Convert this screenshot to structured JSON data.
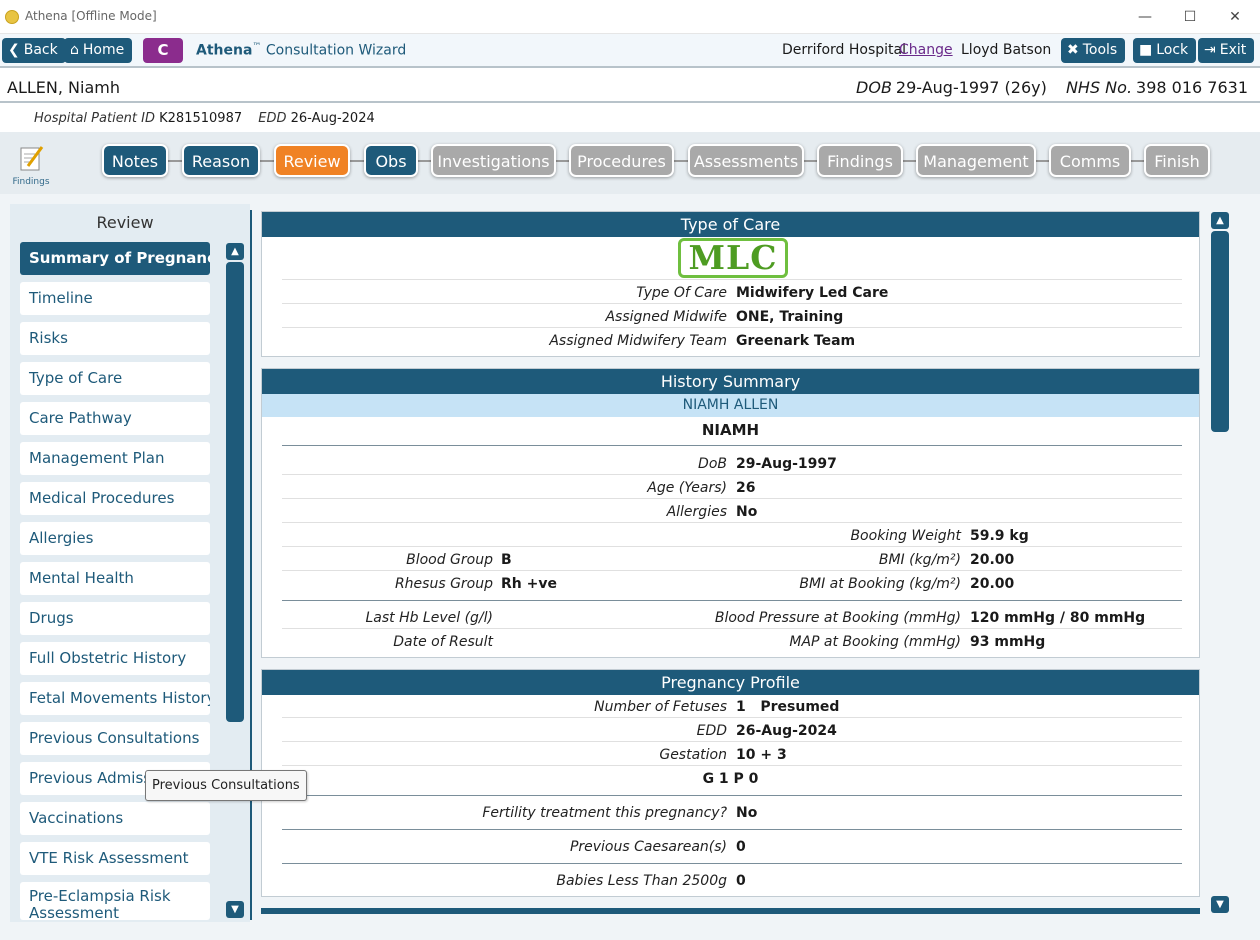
{
  "window": {
    "title": "Athena [Offline Mode]"
  },
  "toolbar": {
    "back_label": "Back",
    "home_label": "Home",
    "c_label": "C",
    "app_name": "Athena",
    "app_tm": "™",
    "app_subtitle": "Consultation Wizard",
    "hospital": "Derriford Hospital",
    "change_link": "Change",
    "user": "Lloyd Batson",
    "tools_label": "Tools",
    "lock_label": "Lock",
    "exit_label": "Exit"
  },
  "patient": {
    "name": "ALLEN, Niamh",
    "dob_label": "DOB",
    "dob_value": "29-Aug-1997 (26y)",
    "nhs_label": "NHS No.",
    "nhs_value": "398 016 7631",
    "hospital_id_label": "Hospital Patient ID",
    "hospital_id_value": "K281510987",
    "edd_label": "EDD",
    "edd_value": "26-Aug-2024"
  },
  "findings_label": "Findings",
  "tabs": [
    {
      "label": "Notes",
      "state": "done"
    },
    {
      "label": "Reason",
      "state": "done"
    },
    {
      "label": "Review",
      "state": "active"
    },
    {
      "label": "Obs",
      "state": "done"
    },
    {
      "label": "Investigations",
      "state": "todo"
    },
    {
      "label": "Procedures",
      "state": "todo"
    },
    {
      "label": "Assessments",
      "state": "todo"
    },
    {
      "label": "Findings",
      "state": "todo"
    },
    {
      "label": "Management",
      "state": "todo"
    },
    {
      "label": "Comms",
      "state": "todo"
    },
    {
      "label": "Finish",
      "state": "todo"
    }
  ],
  "sidebar": {
    "title": "Review",
    "items": [
      {
        "label": "Summary of Pregnancy"
      },
      {
        "label": "Timeline"
      },
      {
        "label": "Risks"
      },
      {
        "label": "Type of Care"
      },
      {
        "label": "Care Pathway"
      },
      {
        "label": "Management Plan"
      },
      {
        "label": "Medical Procedures"
      },
      {
        "label": "Allergies"
      },
      {
        "label": "Mental Health"
      },
      {
        "label": "Drugs"
      },
      {
        "label": "Full Obstetric History"
      },
      {
        "label": "Fetal Movements History"
      },
      {
        "label": "Previous Consultations"
      },
      {
        "label": "Previous Admissions"
      },
      {
        "label": "Vaccinations"
      },
      {
        "label": "VTE Risk Assessment"
      },
      {
        "label": "Pre-Eclampsia Risk Assessment"
      }
    ]
  },
  "tooltip": "Previous Consultations",
  "type_of_care": {
    "header": "Type of Care",
    "stamp": "MLC",
    "rows": [
      {
        "label": "Type Of Care",
        "value": "Midwifery Led Care"
      },
      {
        "label": "Assigned Midwife",
        "value": "ONE, Training"
      },
      {
        "label": "Assigned Midwifery Team",
        "value": "Greenark Team"
      }
    ]
  },
  "history": {
    "header": "History Summary",
    "subheader": "NIAMH ALLEN",
    "name": "NIAMH",
    "dob_label": "DoB",
    "dob_value": "29-Aug-1997",
    "age_label": "Age (Years)",
    "age_value": "26",
    "allergies_label": "Allergies",
    "allergies_value": "No",
    "booking_weight_label": "Booking Weight",
    "booking_weight_value": "59.9 kg",
    "blood_group_label": "Blood Group",
    "blood_group_value": "B",
    "bmi_label": "BMI (kg/m²)",
    "bmi_value": "20.00",
    "rhesus_label": "Rhesus Group",
    "rhesus_value": "Rh +ve",
    "bmi_booking_label": "BMI at Booking (kg/m²)",
    "bmi_booking_value": "20.00",
    "hb_label": "Last Hb Level (g/l)",
    "hb_value": "",
    "bp_label": "Blood Pressure at Booking (mmHg)",
    "bp_value": "120 mmHg / 80 mmHg",
    "result_date_label": "Date of Result",
    "result_date_value": "",
    "map_label": "MAP at Booking (mmHg)",
    "map_value": "93 mmHg"
  },
  "pregnancy": {
    "header": "Pregnancy Profile",
    "fetuses_label": "Number of Fetuses",
    "fetuses_value": "1   Presumed",
    "edd_label": "EDD",
    "edd_value": "26-Aug-2024",
    "gestation_label": "Gestation",
    "gestation_value": "10 + 3",
    "gp_value": "G 1 P 0",
    "fertility_label": "Fertility treatment this pregnancy?",
    "fertility_value": "No",
    "caesarean_label": "Previous Caesarean(s)",
    "caesarean_value": "0",
    "babies_label": "Babies Less Than 2500g",
    "babies_value": "0"
  }
}
